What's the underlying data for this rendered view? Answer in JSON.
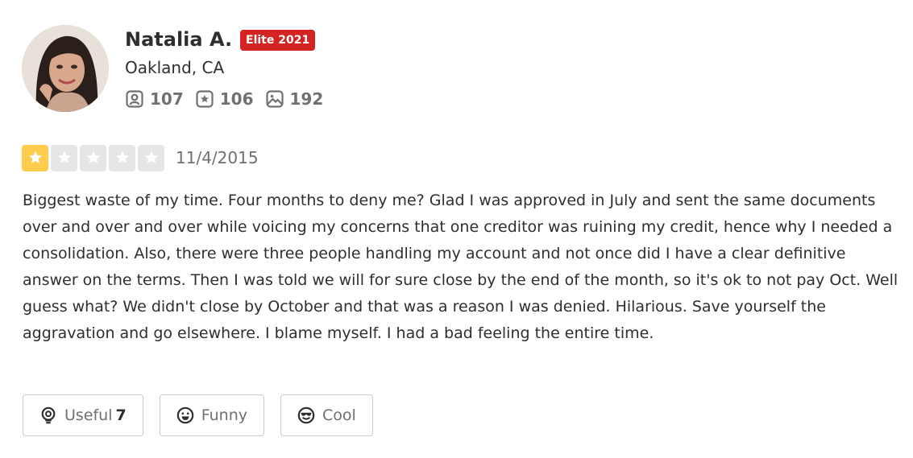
{
  "user": {
    "name": "Natalia A.",
    "badge": "Elite 2021",
    "location": "Oakland, CA",
    "stats": {
      "friends": "107",
      "reviews": "106",
      "photos": "192"
    }
  },
  "review": {
    "rating": 1,
    "max_rating": 5,
    "date": "11/4/2015",
    "text": "Biggest waste of my time. Four months to deny me? Glad I was approved in July and sent the same documents over and over and over while voicing my concerns that one creditor was ruining my credit, hence why I needed a consolidation. Also, there were three people handling my account and not once did I have a clear definitive answer on the terms. Then I was told we will for sure close by the end of the month, so it's ok to not pay Oct. Well guess what? We didn't close by October and that was a reason I was denied. Hilarious. Save yourself the aggravation and go elsewhere. I blame myself. I had a bad feeling the entire time."
  },
  "reactions": {
    "useful_label": "Useful",
    "useful_count": "7",
    "funny_label": "Funny",
    "cool_label": "Cool"
  },
  "colors": {
    "elite_red": "#d32323",
    "star_filled": "#ffcc4b",
    "star_empty": "#e6e6e6",
    "muted_text": "#6e7072"
  },
  "icons": {
    "friends": "friends-icon",
    "reviews": "review-star-icon",
    "photos": "photo-icon",
    "useful": "lightbulb-icon",
    "funny": "laughing-face-icon",
    "cool": "sunglasses-face-icon"
  }
}
